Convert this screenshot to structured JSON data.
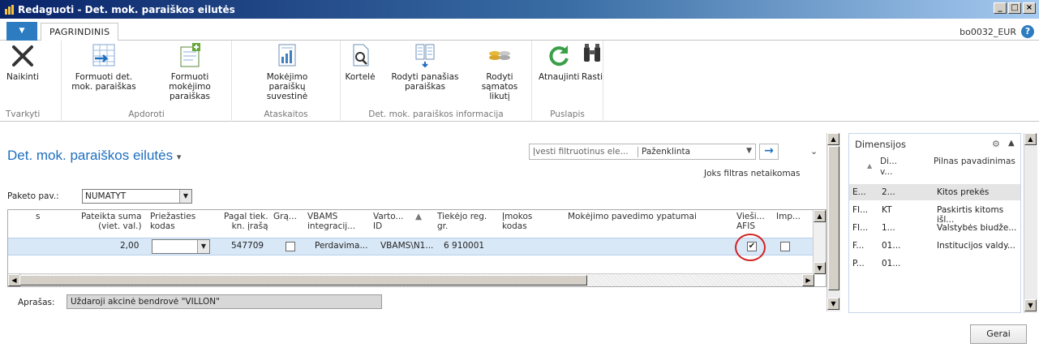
{
  "window": {
    "title": "Redaguoti - Det. mok. paraiškos eilutės",
    "buttons": [
      "_",
      "□",
      "×"
    ]
  },
  "ribbon": {
    "tab_home": "PAGRINDINIS",
    "user": "bo0032_EUR",
    "help": "?",
    "groups": [
      {
        "label": "Tvarkyti",
        "buttons": [
          {
            "label": "Naikinti",
            "icon": "delete-x-icon"
          }
        ]
      },
      {
        "label": "Apdoroti",
        "buttons": [
          {
            "label": "Formuoti det. mok. paraiškas",
            "icon": "form-lines-icon"
          },
          {
            "label": "Formuoti mokėjimo paraiškas",
            "icon": "form-payment-icon"
          }
        ]
      },
      {
        "label": "Ataskaitos",
        "buttons": [
          {
            "label": "Mokėjimo paraiškų suvestinė",
            "icon": "report-icon"
          }
        ]
      },
      {
        "label": "Det. mok. paraiškos informacija",
        "buttons": [
          {
            "label": "Kortelė",
            "icon": "card-icon"
          },
          {
            "label": "Rodyti panašias paraiškas",
            "icon": "similar-icon"
          },
          {
            "label": "Rodyti sąmatos likutį",
            "icon": "budget-icon"
          }
        ]
      },
      {
        "label": "Puslapis",
        "buttons": [
          {
            "label": "Atnaujinti",
            "icon": "refresh-icon"
          },
          {
            "label": "Rasti",
            "icon": "binoculars-icon"
          }
        ]
      }
    ]
  },
  "page": {
    "title": "Det. mok. paraiškos eilutės",
    "filter_placeholder": "Įvesti filtruotinus ele...",
    "filter_field": "Paženklinta",
    "no_filter": "Joks filtras netaikomas",
    "paketo_label": "Paketo pav.:",
    "paketo_value": "NUMATYT"
  },
  "grid": {
    "headers": [
      [
        "s"
      ],
      [
        "Pateikta suma",
        "(viet. val.)"
      ],
      [
        "Priežasties",
        "kodas"
      ],
      [
        "Pagal tiek.",
        "kn. įrašą"
      ],
      [
        "Grą..."
      ],
      [
        "VBAMS",
        "integracij..."
      ],
      [
        "Varto...",
        "ID"
      ],
      [
        "Tiekėjo reg.",
        "gr."
      ],
      [
        "Įmokos",
        "kodas"
      ],
      [
        "Mokėjimo pavedimo ypatumai"
      ],
      [
        "Vieši...",
        "AFIS"
      ],
      [
        "Imp..."
      ]
    ],
    "row": {
      "suma": "2,00",
      "priezasties_kodas": "",
      "pagal_tiek": "547709",
      "gra": false,
      "vbams": "Perdavima...",
      "varto_id": "VBAMS\\N1...",
      "tiekejo_reg": "6 910001",
      "imokos_kodas": "",
      "ypatumai": "",
      "viesi_afis": true,
      "imp": false
    }
  },
  "aprasas": {
    "label": "Aprašas:",
    "value": "Uždaroji akcinė bendrovė \"VILLON\""
  },
  "factbox": {
    "title": "Dimensijos",
    "header_col1": [
      "Di...",
      "v..."
    ],
    "header_col2": "Pilnas pavadinimas",
    "rows": [
      {
        "c1": "E...",
        "c2": "2...",
        "c3": "Kitos prekės"
      },
      {
        "c1": "FI...",
        "c2": "KT",
        "c3": "Paskirtis kitoms išl..."
      },
      {
        "c1": "FI...",
        "c2": "1...",
        "c3": "Valstybės biudže..."
      },
      {
        "c1": "F...",
        "c2": "01...",
        "c3": "Institucijos valdy..."
      },
      {
        "c1": "P...",
        "c2": "01...",
        "c3": ""
      }
    ]
  },
  "ok_button": "Gerai"
}
